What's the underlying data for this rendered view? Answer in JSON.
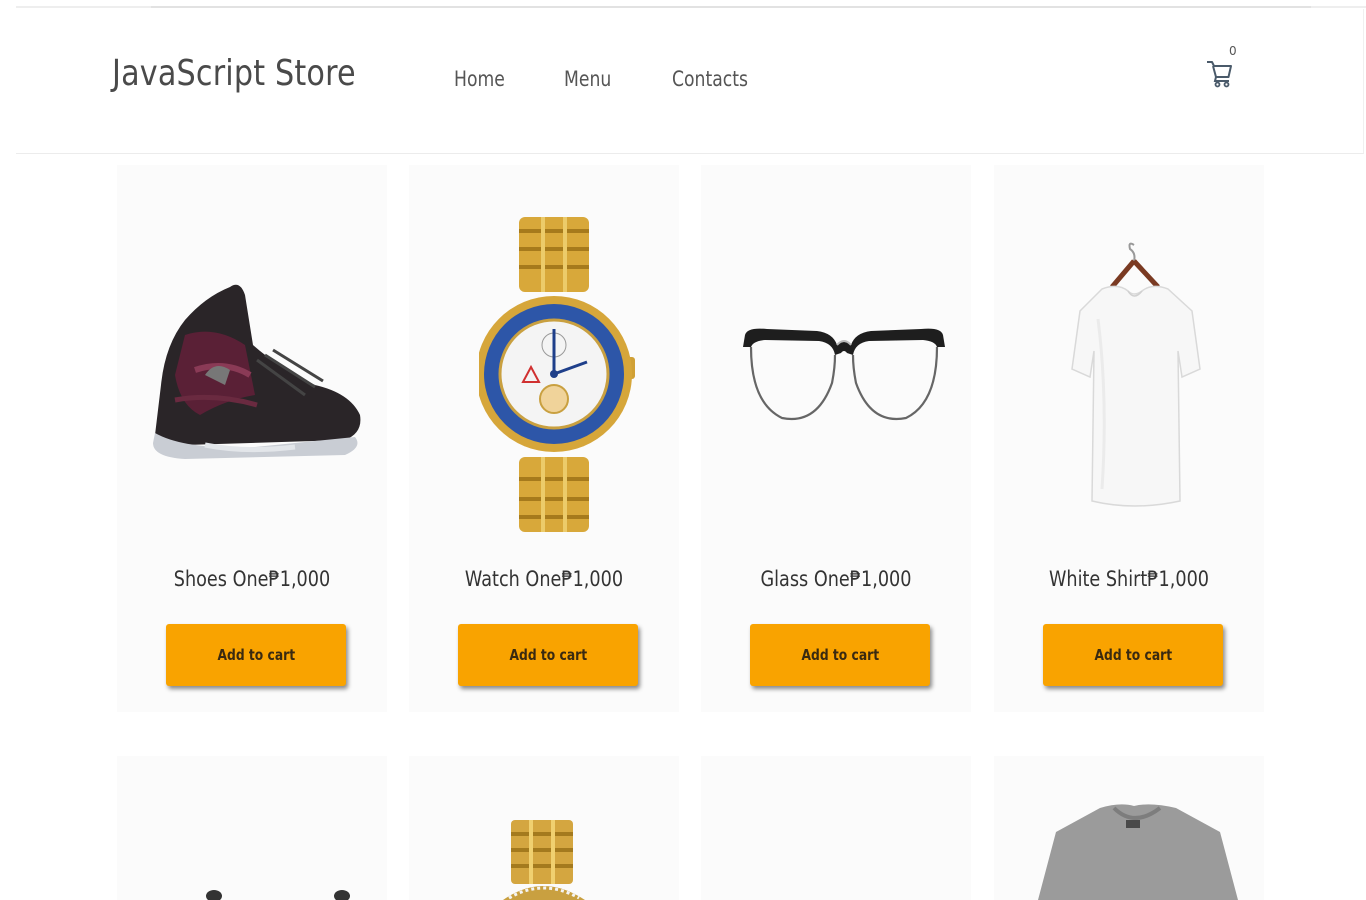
{
  "header": {
    "brand": "JavaScript Store",
    "nav": [
      {
        "label": "Home"
      },
      {
        "label": "Menu"
      },
      {
        "label": "Contacts"
      }
    ],
    "cart": {
      "count": "0",
      "icon": "shopping-cart-icon"
    }
  },
  "products": [
    {
      "name": "Shoes One",
      "price": "₱1,000",
      "label": "Shoes One₱1,000",
      "button": "Add to cart",
      "image": "sneaker-image"
    },
    {
      "name": "Watch One",
      "price": "₱1,000",
      "label": "Watch One₱1,000",
      "button": "Add to cart",
      "image": "gold-watch-image"
    },
    {
      "name": "Glass One",
      "price": "₱1,000",
      "label": "Glass One₱1,000",
      "button": "Add to cart",
      "image": "eyeglasses-image"
    },
    {
      "name": "White Shirt",
      "price": "₱1,000",
      "label": "White Shirt₱1,000",
      "button": "Add to cart",
      "image": "white-tshirt-image"
    }
  ],
  "second_row_images": [
    "sneaker-image",
    "gold-watch-image",
    "blank-image",
    "grey-tshirt-image"
  ],
  "colors": {
    "accent": "#f9a300",
    "card_bg": "#fbfbfb"
  }
}
